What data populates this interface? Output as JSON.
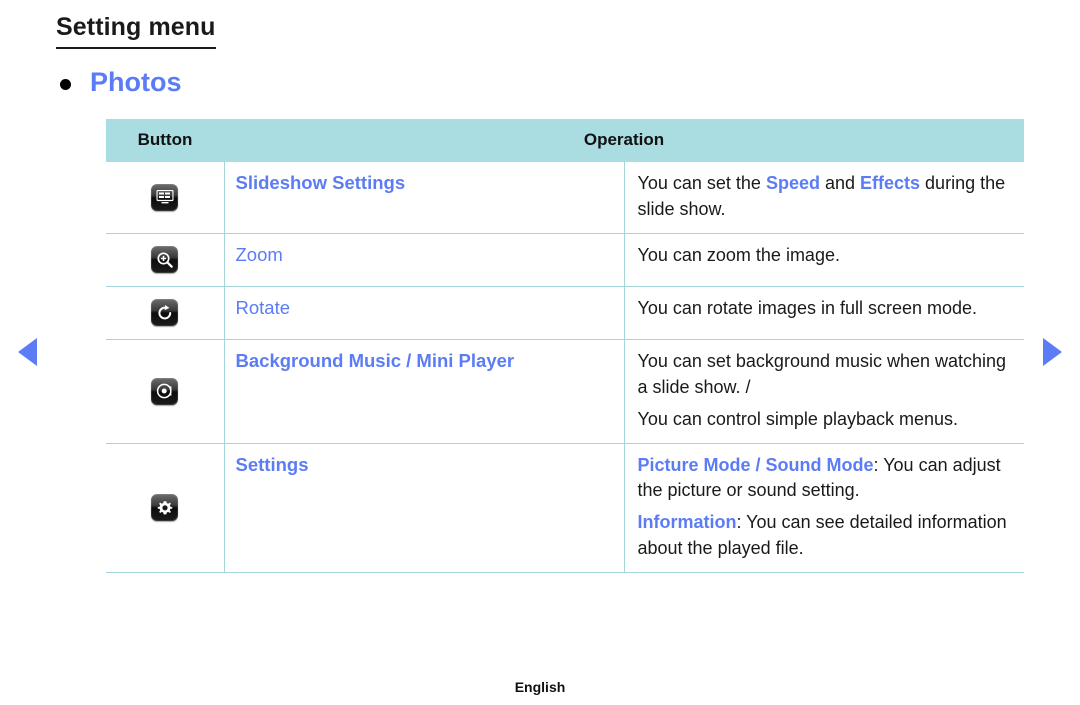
{
  "header": {
    "title": "Setting menu",
    "section_bullet": "•",
    "section_label": "Photos"
  },
  "nav": {
    "prev_icon": "triangle-left-icon",
    "next_icon": "triangle-right-icon",
    "arrow_color": "#5c7cf5"
  },
  "table": {
    "columns": [
      {
        "label": "Button"
      },
      {
        "label": "Operation"
      }
    ],
    "header_bg": "#aadde1",
    "border_color": "#a3d6db",
    "accent_color": "#5c7cf5",
    "rows": [
      {
        "icon": "slideshow-settings-icon",
        "name": "Slideshow Settings",
        "name_bold": true,
        "description_parts": [
          [
            {
              "text": "You can set the ",
              "highlight": false
            },
            {
              "text": "Speed",
              "highlight": true
            },
            {
              "text": " and ",
              "highlight": false
            },
            {
              "text": "Effects",
              "highlight": true
            },
            {
              "text": " during the slide show.",
              "highlight": false
            }
          ]
        ]
      },
      {
        "icon": "zoom-in-icon",
        "name": "Zoom",
        "name_bold": false,
        "description_parts": [
          [
            {
              "text": "You can zoom the image.",
              "highlight": false
            }
          ]
        ]
      },
      {
        "icon": "rotate-icon",
        "name": "Rotate",
        "name_bold": false,
        "description_parts": [
          [
            {
              "text": "You can rotate images in full screen mode.",
              "highlight": false
            }
          ]
        ]
      },
      {
        "icon": "background-music-icon",
        "name": "Background Music /\nMini Player",
        "name_bold": true,
        "description_parts": [
          [
            {
              "text": "You can set background music when watching a slide show. /",
              "highlight": false
            }
          ],
          [
            {
              "text": "You can control simple playback menus.",
              "highlight": false
            }
          ]
        ]
      },
      {
        "icon": "settings-gear-icon",
        "name": "Settings",
        "name_bold": true,
        "description_parts": [
          [
            {
              "text": "Picture Mode / Sound Mode",
              "highlight": true
            },
            {
              "text": ": You can adjust the picture or sound setting.",
              "highlight": false
            }
          ],
          [
            {
              "text": "Information",
              "highlight": true
            },
            {
              "text": ": You can see detailed information about the played file.",
              "highlight": false
            }
          ]
        ]
      }
    ]
  },
  "footer": {
    "language": "English"
  }
}
